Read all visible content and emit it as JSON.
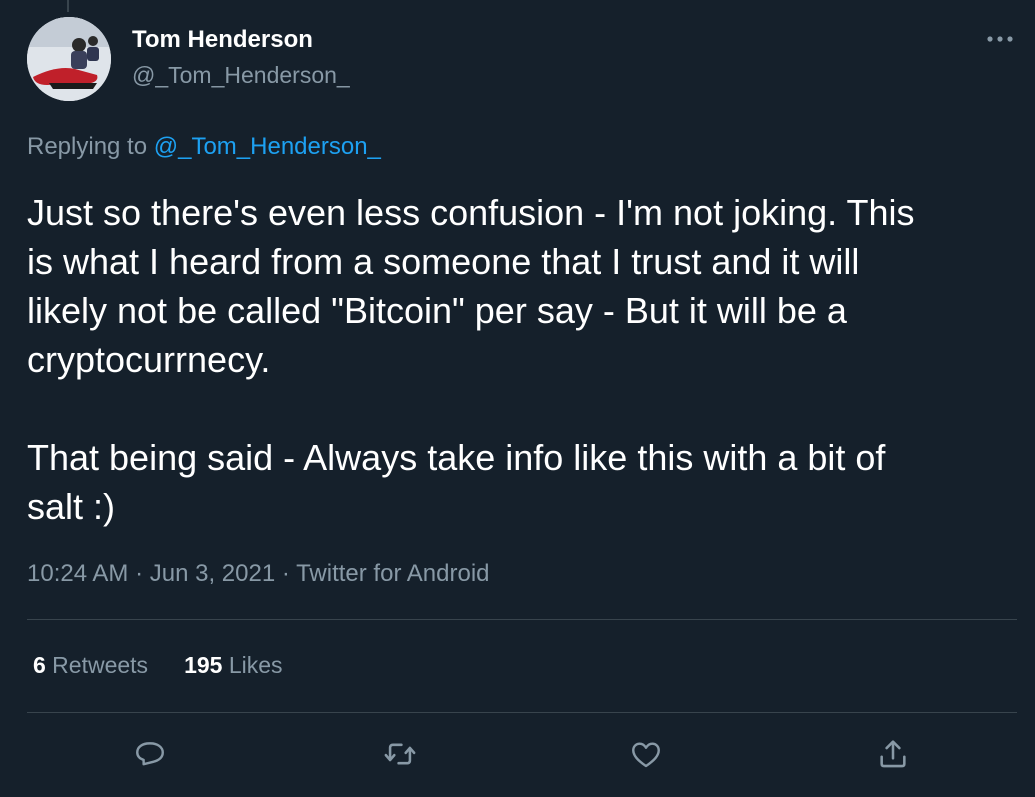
{
  "author": {
    "display_name": "Tom Henderson",
    "handle": "@_Tom_Henderson_"
  },
  "reply": {
    "prefix": "Replying to ",
    "mention": "@_Tom_Henderson_"
  },
  "tweet": {
    "text": "Just so there's even less confusion - I'm not joking. This\nis what I heard from a someone that I trust and it will\nlikely not be called \"Bitcoin\" per say - But it will be a\ncryptocurrnecy.\n\nThat being said - Always take info like this with a bit of\nsalt :)"
  },
  "meta": {
    "time": "10:24 AM",
    "sep1": " · ",
    "date": "Jun 3, 2021",
    "sep2": " · ",
    "source": "Twitter for Android"
  },
  "stats": {
    "retweets_count": "6",
    "retweets_label": " Retweets",
    "likes_count": "195",
    "likes_label": " Likes"
  },
  "icons": {
    "more": "more-icon",
    "reply": "reply-icon",
    "retweet": "retweet-icon",
    "like": "like-icon",
    "share": "share-icon"
  },
  "colors": {
    "background": "#15202b",
    "text": "#ffffff",
    "secondary": "#8899a6",
    "accent": "#1da1f2",
    "divider": "#38444d"
  }
}
